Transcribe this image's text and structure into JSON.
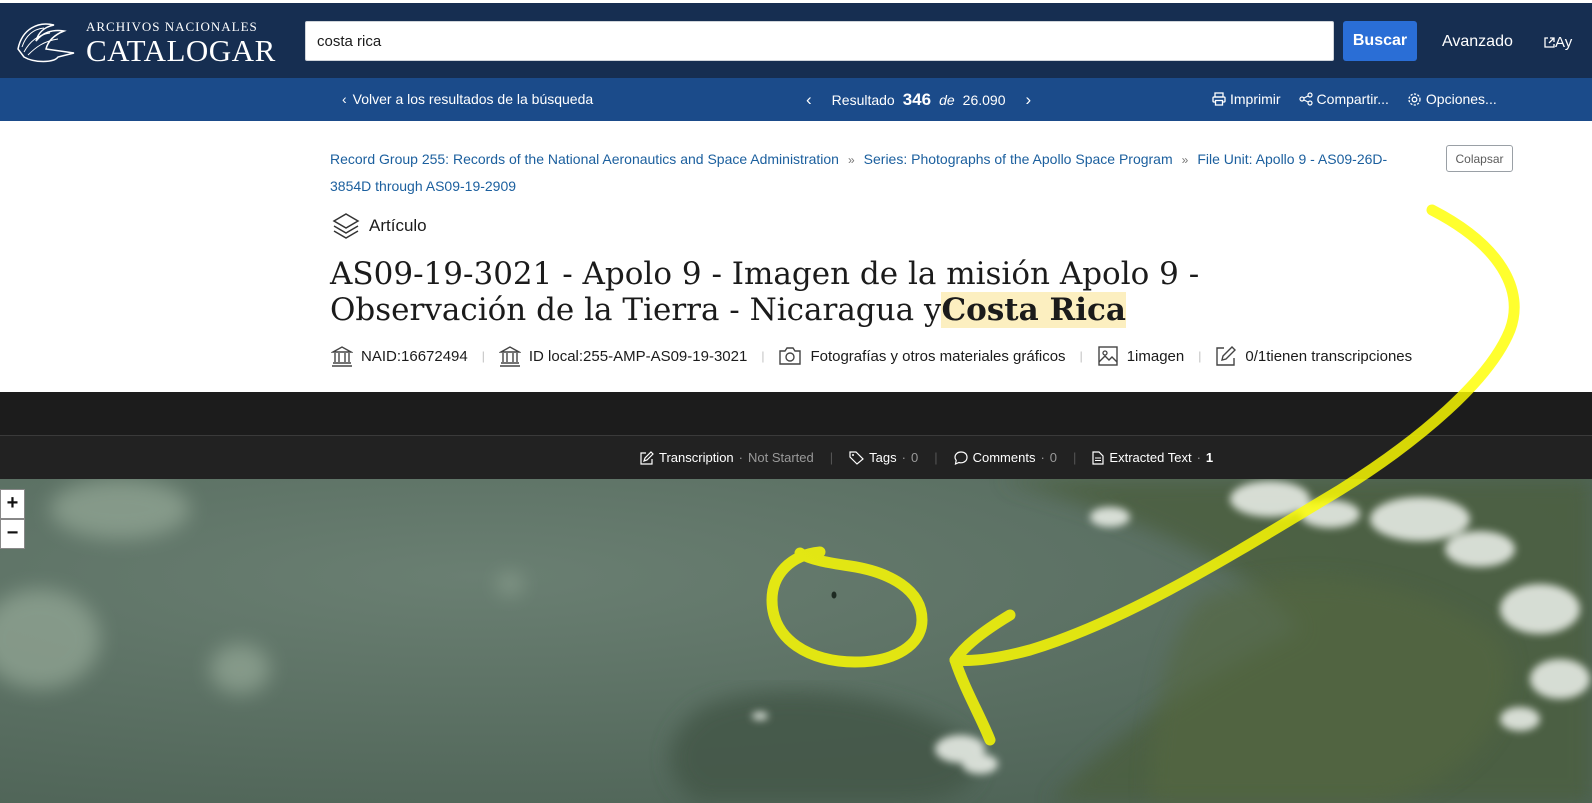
{
  "header": {
    "logo_small": "Archivos Nacionales",
    "logo_big": "CATALOGAR",
    "search_value": "costa rica",
    "search_button": "Buscar",
    "advanced_link": "Avanzado",
    "help_link": "Ay"
  },
  "nav": {
    "back": "Volver a los resultados de la búsqueda",
    "result_label": "Resultado",
    "result_number": "346",
    "result_of": "de",
    "result_total": "26.090",
    "print": "Imprimir",
    "share": "Compartir...",
    "options": "Opciones..."
  },
  "breadcrumb": {
    "item1": "Record Group 255: Records of the National Aeronautics and Space Administration",
    "item2": "Series: Photographs of the Apollo Space Program",
    "item3": "File Unit: Apollo 9 - AS09-26D-3854D through AS09-19-2909",
    "collapse_button": "Colapsar"
  },
  "record": {
    "type_label": "Artículo",
    "title_main": "AS09-19-3021 - Apolo 9 - Imagen de la misión Apolo 9 - Observación de la Tierra - Nicaragua y",
    "title_highlight": "Costa Rica",
    "naid": "NAID:16672494",
    "local_id": "ID local:255-AMP-AS09-19-3021",
    "category": "Fotografías y otros materiales gráficos",
    "images": "1imagen",
    "transcriptions": "0/1tienen transcripciones"
  },
  "viewer": {
    "transcription_label": "Transcription",
    "transcription_status": "Not Started",
    "tags_label": "Tags",
    "tags_count": "0",
    "comments_label": "Comments",
    "comments_count": "0",
    "extracted_label": "Extracted Text",
    "extracted_count": "1",
    "zoom_in": "+",
    "zoom_out": "−"
  },
  "colors": {
    "header_bg": "#162e51",
    "nav_bg": "#1b4b8a",
    "button_blue": "#2a6ed6",
    "link_blue": "#1b5f9e",
    "highlight": "#fcefc0",
    "annotation_yellow": "#ffff00"
  }
}
